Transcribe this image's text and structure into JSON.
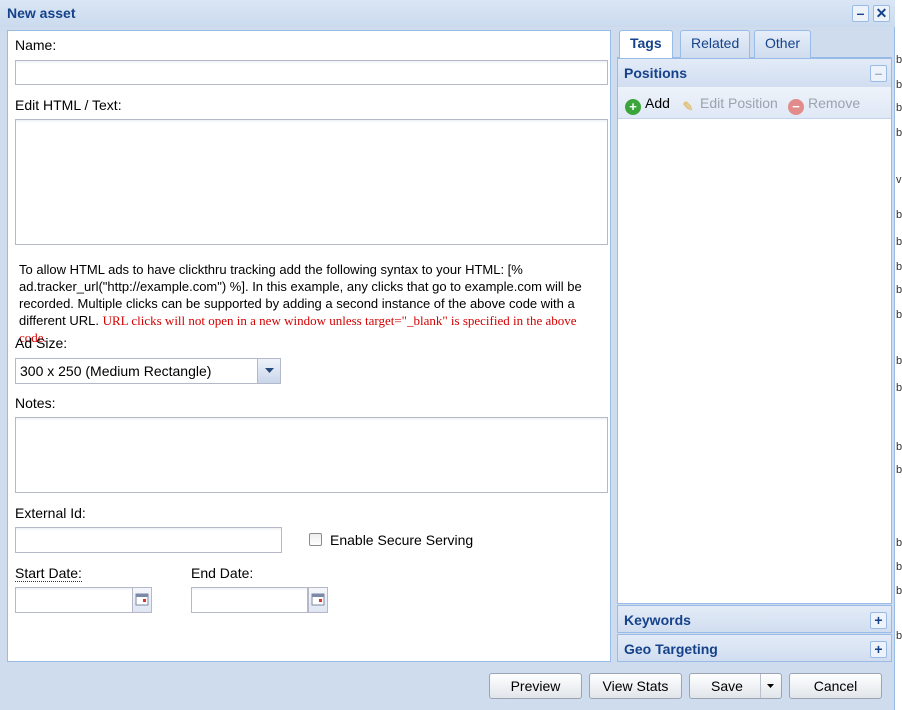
{
  "window": {
    "title": "New asset"
  },
  "form": {
    "name_label": "Name:",
    "name_value": "",
    "html_label": "Edit HTML / Text:",
    "html_value": "",
    "help_text": "To allow HTML ads to have clickthru tracking add the following syntax to your HTML: [% ad.tracker_url(\"http://example.com\") %]. In this example, any clicks that go to example.com will be recorded. Multiple clicks can be supported by adding a second instance of the above code with a different URL.",
    "help_warning": "URL clicks will not open in a new window unless target=\"_blank\" is specified in the above code.",
    "ad_size_label": "Ad Size:",
    "ad_size_value": "300 x 250 (Medium Rectangle)",
    "notes_label": "Notes:",
    "external_id_label": "External Id:",
    "secure_label": "Enable Secure Serving",
    "start_date_label": "Start Date:",
    "end_date_label": "End Date:"
  },
  "tabs": [
    {
      "label": "Tags",
      "active": true
    },
    {
      "label": "Related",
      "active": false
    },
    {
      "label": "Other",
      "active": false
    }
  ],
  "positions": {
    "title": "Positions",
    "add_label": "Add",
    "edit_label": "Edit Position",
    "remove_label": "Remove"
  },
  "keywords": {
    "title": "Keywords"
  },
  "geo": {
    "title": "Geo Targeting"
  },
  "buttons": {
    "preview": "Preview",
    "view_stats": "View Stats",
    "save": "Save",
    "cancel": "Cancel"
  },
  "colors": {
    "header_text": "#15428b",
    "warning_text": "#d40000",
    "add_icon": "#3ba53b",
    "remove_icon": "#e28b8b"
  }
}
